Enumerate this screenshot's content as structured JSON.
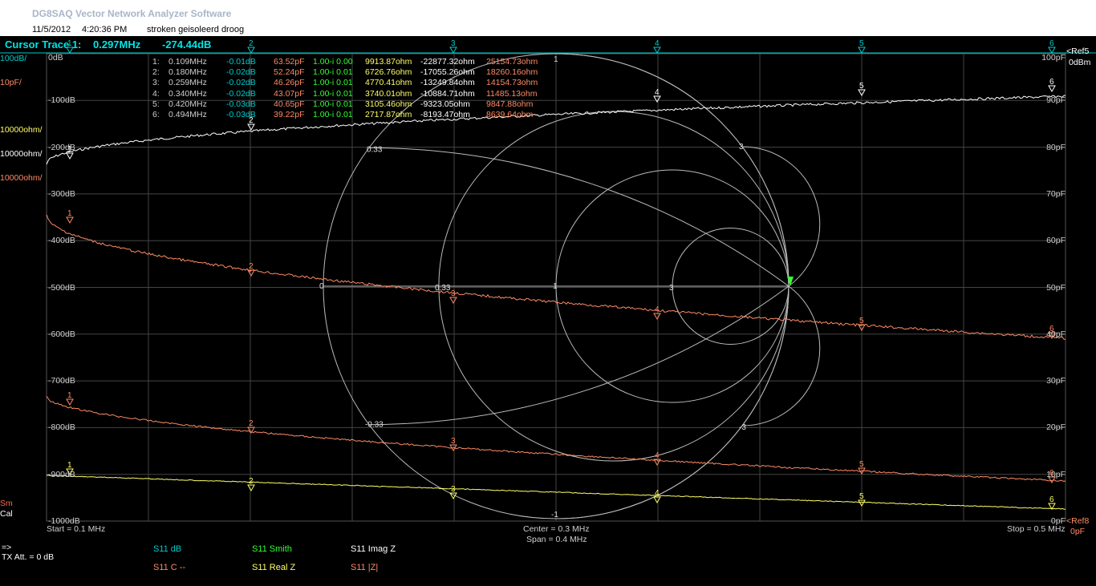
{
  "window": {
    "title": "DG8SAQ Vector Network Analyzer Software",
    "date": "11/5/2012",
    "time": "4:20:36 PM",
    "comment": "stroken geisoleerd droog"
  },
  "cursor": {
    "label": "Cursor Trace 1:",
    "freq": "0.297MHz",
    "value": "-274.44dB"
  },
  "left_scale": {
    "db_per_div": "100dB/",
    "pf_per_div": "10pF/",
    "ohm_per_div_1": "10000ohm/",
    "ohm_per_div_2": "10000ohm/",
    "ohm_per_div_3": "10000ohm/",
    "sm_label": "Sm",
    "cal_label": "Cal",
    "db_ticks": [
      "0dB",
      "-100dB",
      "-200dB",
      "-300dB",
      "-400dB",
      "-500dB",
      "-600dB",
      "-700dB",
      "-800dB",
      "-900dB",
      "-1000dB"
    ]
  },
  "right_scale": {
    "pf_ticks": [
      "100pF",
      "90pF",
      "80pF",
      "70pF",
      "60pF",
      "50pF",
      "40pF",
      "30pF",
      "20pF",
      "10pF",
      "0pF"
    ],
    "ref_top_1": "<Ref5",
    "ref_top_2": "0dBm",
    "ref_bottom_1": "<Ref8",
    "ref_bottom_2": "0pF"
  },
  "markers": {
    "numbers": [
      "1",
      "2",
      "3",
      "4",
      "5",
      "6"
    ],
    "rows": [
      {
        "n": "1:",
        "freq": "0.109MHz",
        "db": "-0.01dB",
        "c": "63.52pF",
        "smith": "1.00-i 0.00",
        "real": "9913.87ohm",
        "imag": "-22877.32ohm",
        "abs": "25154.73ohm"
      },
      {
        "n": "2:",
        "freq": "0.180MHz",
        "db": "-0.02dB",
        "c": "52.24pF",
        "smith": "1.00-i 0.01",
        "real": "6726.76ohm",
        "imag": "-17055.26ohm",
        "abs": "18260.16ohm"
      },
      {
        "n": "3:",
        "freq": "0.259MHz",
        "db": "-0.02dB",
        "c": "46.26pF",
        "smith": "1.00-i 0.01",
        "real": "4770.41ohm",
        "imag": "-13249.84ohm",
        "abs": "14154.73ohm"
      },
      {
        "n": "4:",
        "freq": "0.340MHz",
        "db": "-0.02dB",
        "c": "43.07pF",
        "smith": "1.00-i 0.01",
        "real": "3740.01ohm",
        "imag": "-10884.71ohm",
        "abs": "11485.13ohm"
      },
      {
        "n": "5:",
        "freq": "0.420MHz",
        "db": "-0.03dB",
        "c": "40.65pF",
        "smith": "1.00-i 0.01",
        "real": "3105.46ohm",
        "imag": "-9323.05ohm",
        "abs": "9847.88ohm"
      },
      {
        "n": "6:",
        "freq": "0.494MHz",
        "db": "-0.03dB",
        "c": "39.22pF",
        "smith": "1.00-i 0.01",
        "real": "2717.87ohm",
        "imag": "-8193.47ohm",
        "abs": "8639.64ohm"
      }
    ]
  },
  "smith_labels": {
    "r0": "0",
    "r033": "0.33",
    "r1": "1",
    "r3": "3",
    "x_p033": "0.33",
    "x_p1": "1",
    "x_p3": "3",
    "x_m033": "-0.33",
    "x_m1": "-1",
    "x_m3": "-3"
  },
  "bottom": {
    "start": "Start = 0.1 MHz",
    "center": "Center = 0.3 MHz",
    "span": "Span = 0.4 MHz",
    "stop": "Stop = 0.5 MHz",
    "arrow": "=>",
    "tx_att": "TX Att.   = 0 dB"
  },
  "legend": {
    "s11_db": "S11  dB",
    "s11_c": "S11  C --",
    "s11_smith": "S11  Smith",
    "s11_realz": "S11  Real Z",
    "s11_imagz": "S11  Imag Z",
    "s11_absz": "S11  |Z|"
  },
  "colors": {
    "cyan": "#00cccc",
    "orange": "#ff8a65",
    "white": "#ffffff",
    "yellow": "#ffff66",
    "green": "#33ff33",
    "grid": "#555555"
  }
}
